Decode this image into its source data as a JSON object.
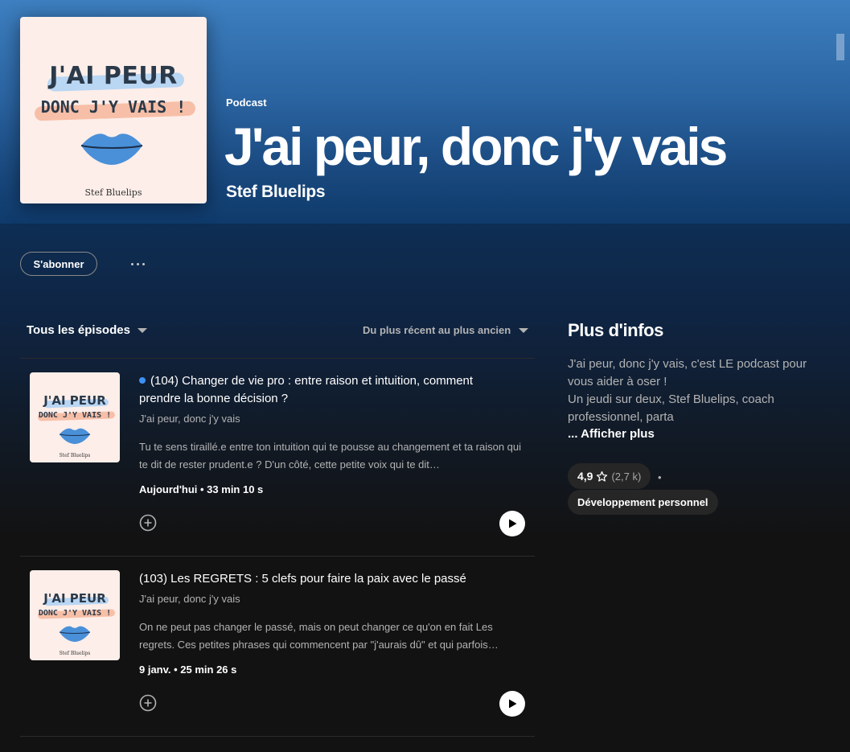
{
  "podcast": {
    "type_label": "Podcast",
    "title": "J'ai peur, donc j'y vais",
    "author": "Stef Bluelips",
    "cover_line1": "J'AI PEUR",
    "cover_line2": "DONC J'Y VAIS !",
    "cover_author": "Stef Bluelips"
  },
  "actions": {
    "subscribe_label": "S'abonner",
    "more_label": "..."
  },
  "episodes_header": {
    "filter_label": "Tous les épisodes",
    "sort_label": "Du plus récent au plus ancien"
  },
  "episodes": [
    {
      "title": "(104) Changer de vie pro : entre raison et intuition, comment prendre la bonne décision ?",
      "is_new": true,
      "show": "J'ai peur, donc j'y vais",
      "description": "Tu te sens tiraillé.e entre ton intuition qui te pousse au changement et ta raison qui te dit de rester prudent.e ?  D'un côté, cette petite voix qui te dit…",
      "meta": "Aujourd'hui • 33 min 10 s"
    },
    {
      "title": "(103) Les REGRETS : 5 clefs pour faire la paix avec le passé",
      "is_new": false,
      "show": "J'ai peur, donc j'y vais",
      "description": "On ne peut pas changer le passé, mais on peut changer ce qu'on en fait Les regrets. Ces petites phrases qui commencent par \"j'aurais dû\" et qui parfois…",
      "meta": "9 janv. • 25 min 26 s"
    }
  ],
  "info": {
    "heading": "Plus d'infos",
    "description_line1": "J'ai peur, donc j'y vais, c'est LE podcast pour vous aider à oser !",
    "description_line2": "Un jeudi sur deux, Stef Bluelips, coach professionnel, parta",
    "show_more": "... Afficher plus",
    "rating_value": "4,9",
    "rating_count": "(2,7 k)",
    "separator": "•",
    "category": "Développement personnel"
  },
  "colors": {
    "hero_top": "#3d7fc0",
    "background": "#121212",
    "new_dot": "#3d91f4",
    "cover_bg": "#fdeee9",
    "lips_blue": "#4a90d9"
  },
  "icons": {
    "filter_caret": "chevron-down-icon",
    "sort_caret": "chevron-down-icon",
    "add": "plus-circle-icon",
    "play": "play-icon",
    "star": "star-icon"
  }
}
